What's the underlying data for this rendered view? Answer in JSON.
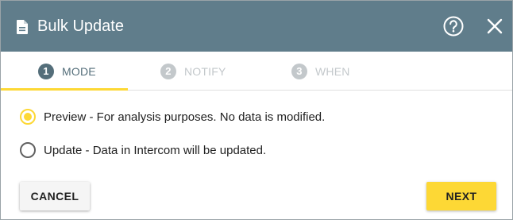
{
  "dialog": {
    "title": "Bulk Update",
    "title_icon": "document-icon",
    "help_icon": "help-circle-icon",
    "close_icon": "close-icon"
  },
  "steps": [
    {
      "number": "1",
      "label": "MODE",
      "active": true
    },
    {
      "number": "2",
      "label": "NOTIFY",
      "active": false
    },
    {
      "number": "3",
      "label": "WHEN",
      "active": false
    }
  ],
  "options": [
    {
      "label": "Preview - For analysis purposes. No data is modified.",
      "selected": true
    },
    {
      "label": "Update - Data in Intercom will be updated.",
      "selected": false
    }
  ],
  "buttons": {
    "cancel": "CANCEL",
    "next": "NEXT"
  },
  "colors": {
    "header": "#607d8b",
    "accent": "#fdd835",
    "active_step": "#546e7a",
    "inactive_step": "#c3c8cb"
  }
}
